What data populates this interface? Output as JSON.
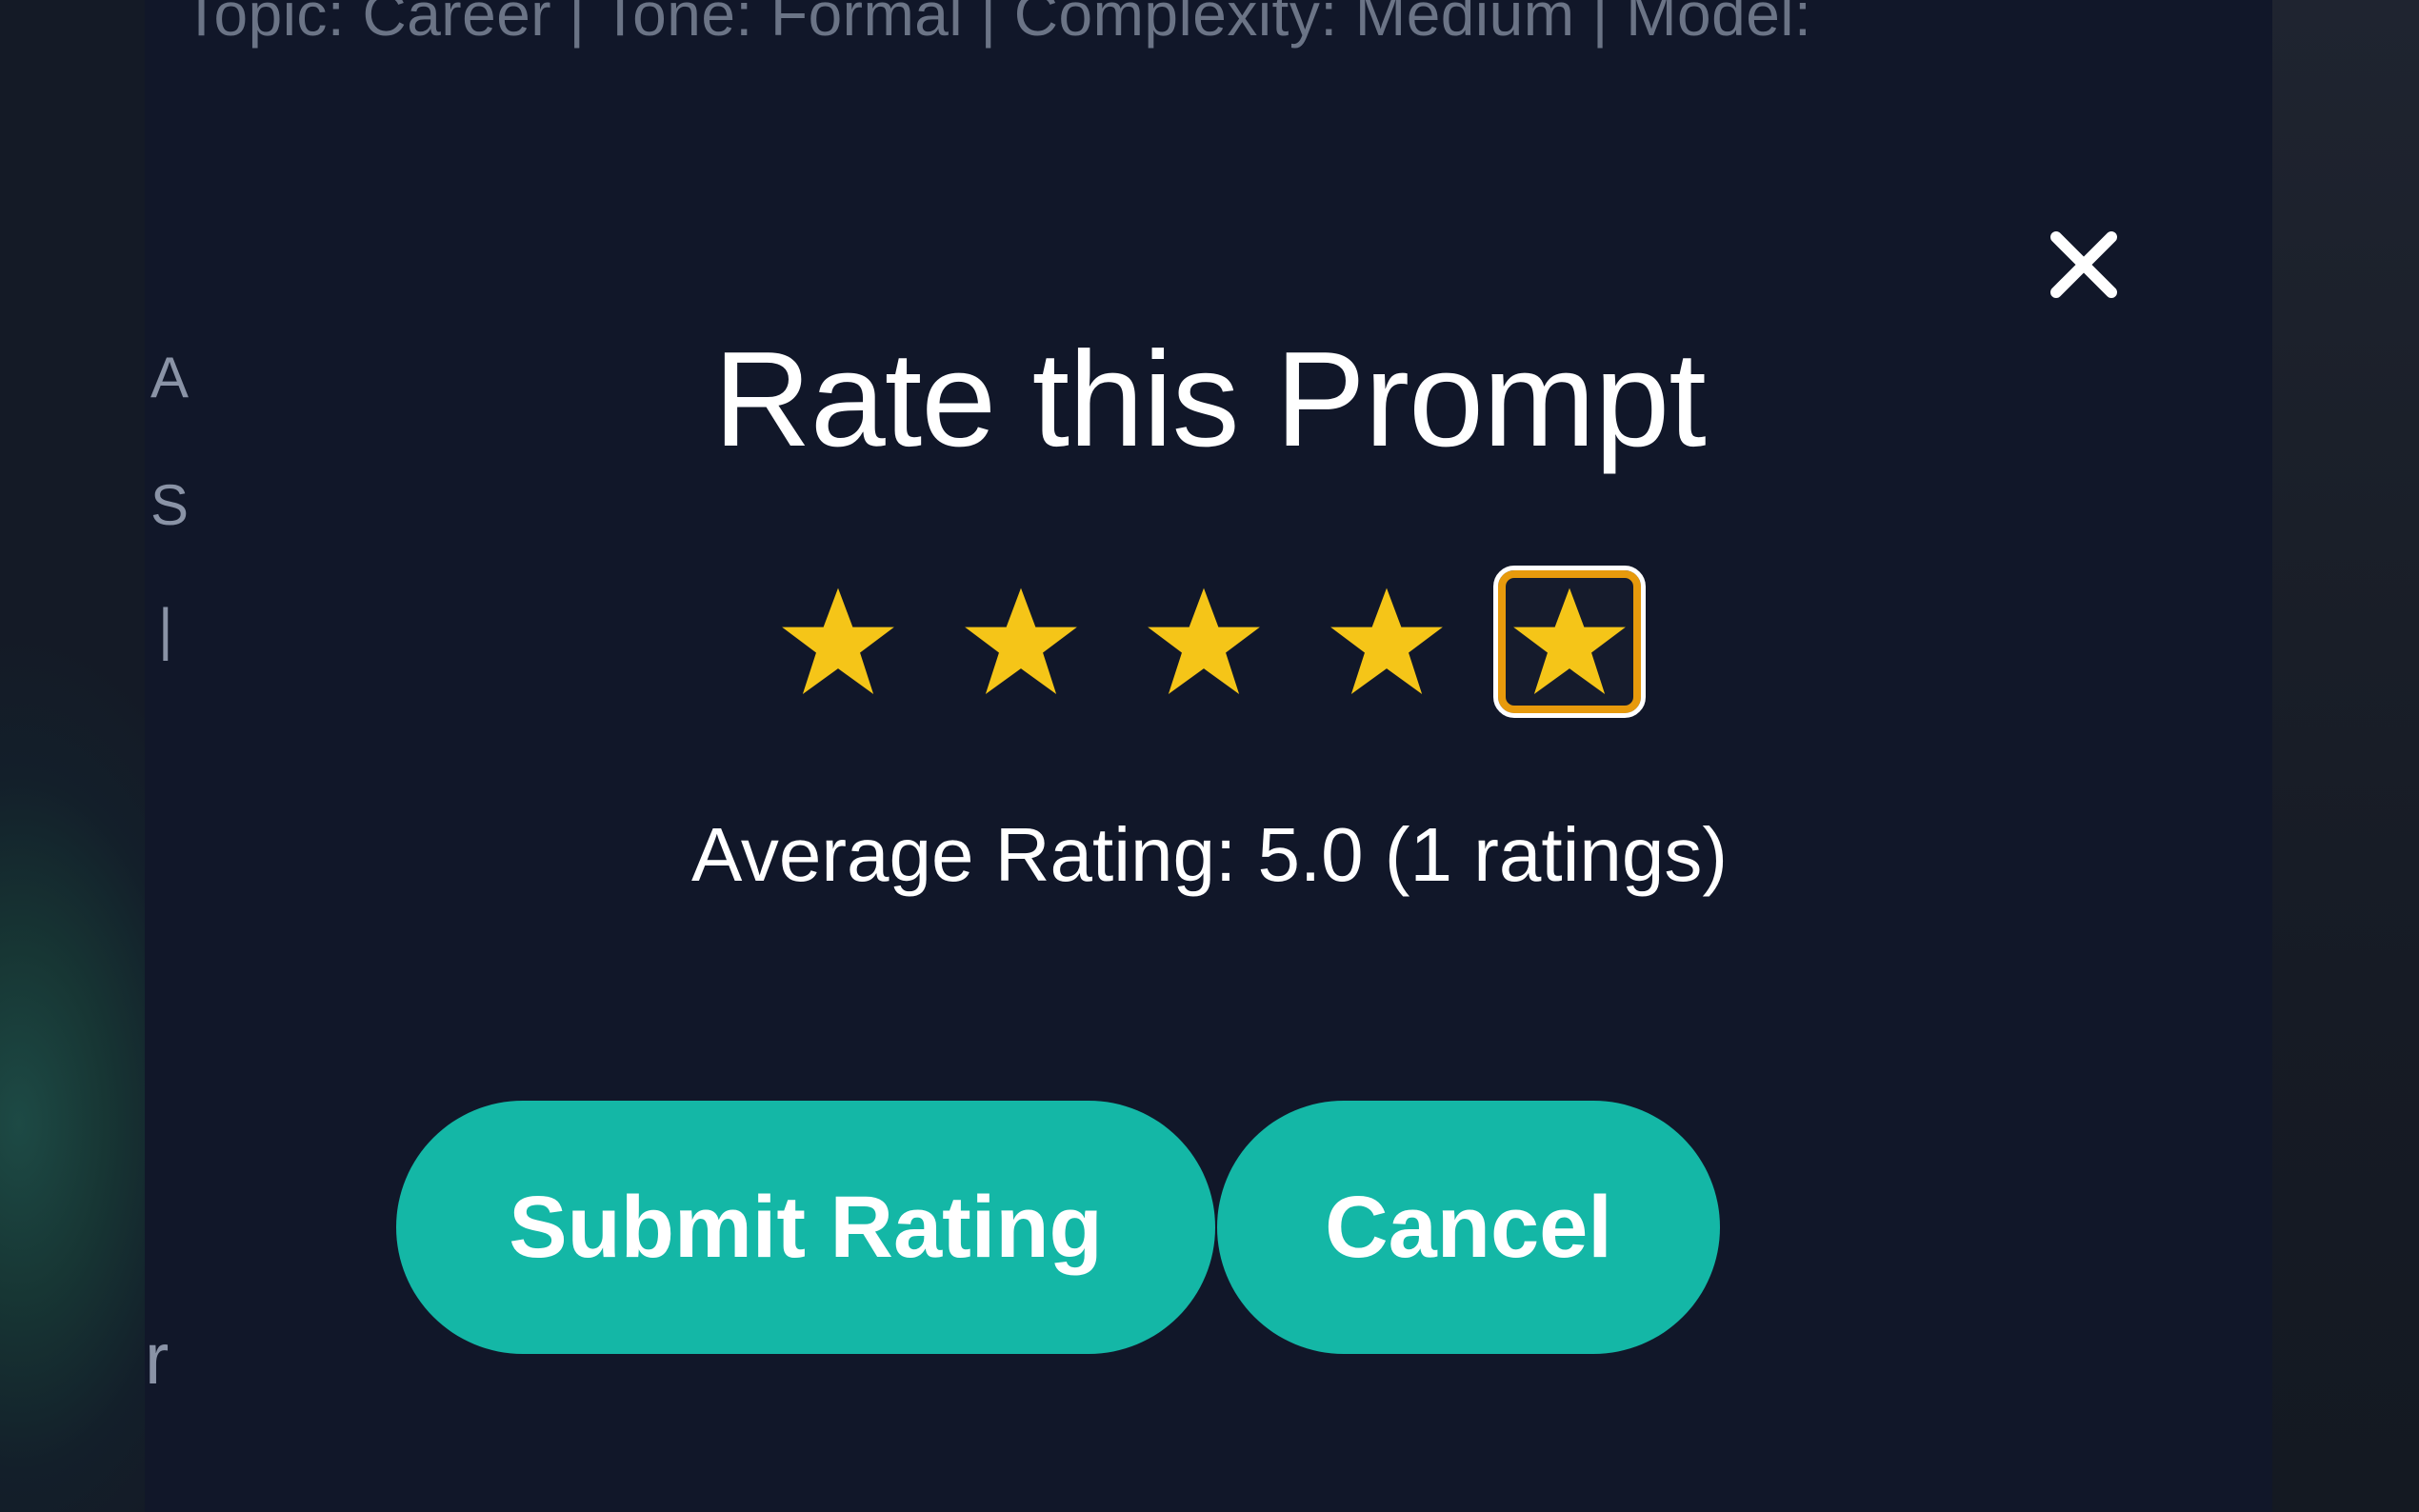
{
  "background": {
    "meta_line": "Topic: Career | Tone: Formal | Complexity: Medium | Model:",
    "fragments": [
      "A",
      "S",
      "|",
      "r"
    ]
  },
  "modal": {
    "title": "Rate this Prompt",
    "close_icon": "close-icon",
    "rating": {
      "selected": 5,
      "max": 5,
      "star_icon": "star-icon",
      "star_color": "#f5c518"
    },
    "average_text": "Average Rating: 5.0 (1 ratings)",
    "submit_label": "Submit Rating",
    "cancel_label": "Cancel"
  },
  "colors": {
    "panel_bg": "#111729",
    "accent": "#14b7a6",
    "star": "#f5c518",
    "focus_ring": "#e79a0c"
  }
}
